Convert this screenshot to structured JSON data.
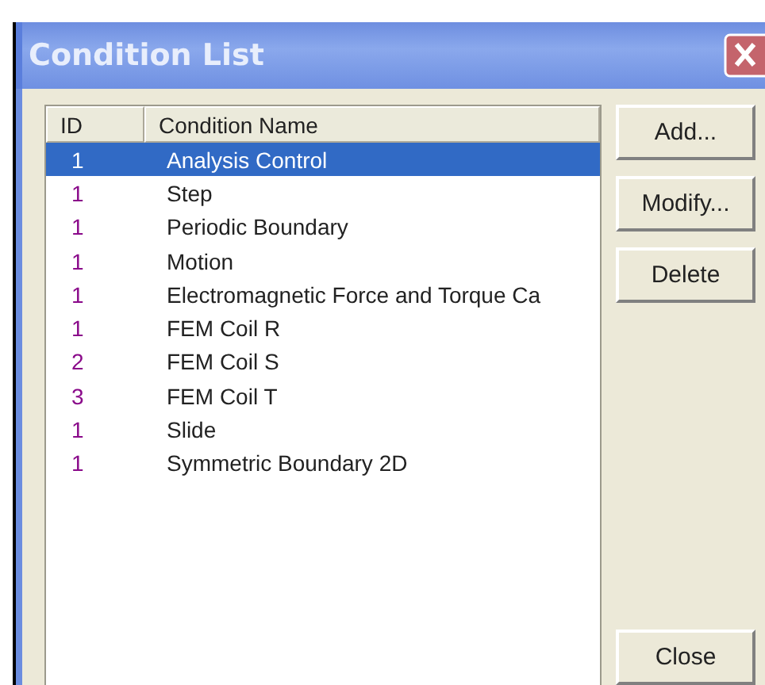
{
  "window": {
    "title": "Condition List"
  },
  "table": {
    "columns": [
      "ID",
      "Condition Name"
    ],
    "rows": [
      {
        "id": "1",
        "name": "Analysis Control",
        "selected": true
      },
      {
        "id": "1",
        "name": "Step",
        "selected": false
      },
      {
        "id": "1",
        "name": "Periodic Boundary",
        "selected": false
      },
      {
        "id": "1",
        "name": "Motion",
        "selected": false
      },
      {
        "id": "1",
        "name": "Electromagnetic Force and Torque Ca",
        "selected": false
      },
      {
        "id": "1",
        "name": "FEM Coil R",
        "selected": false
      },
      {
        "id": "2",
        "name": "FEM Coil S",
        "selected": false
      },
      {
        "id": "3",
        "name": "FEM Coil T",
        "selected": false
      },
      {
        "id": "1",
        "name": "Slide",
        "selected": false
      },
      {
        "id": "1",
        "name": "Symmetric Boundary 2D",
        "selected": false
      }
    ]
  },
  "buttons": [
    "Add...",
    "Modify...",
    "Delete"
  ],
  "close_button": "Close"
}
